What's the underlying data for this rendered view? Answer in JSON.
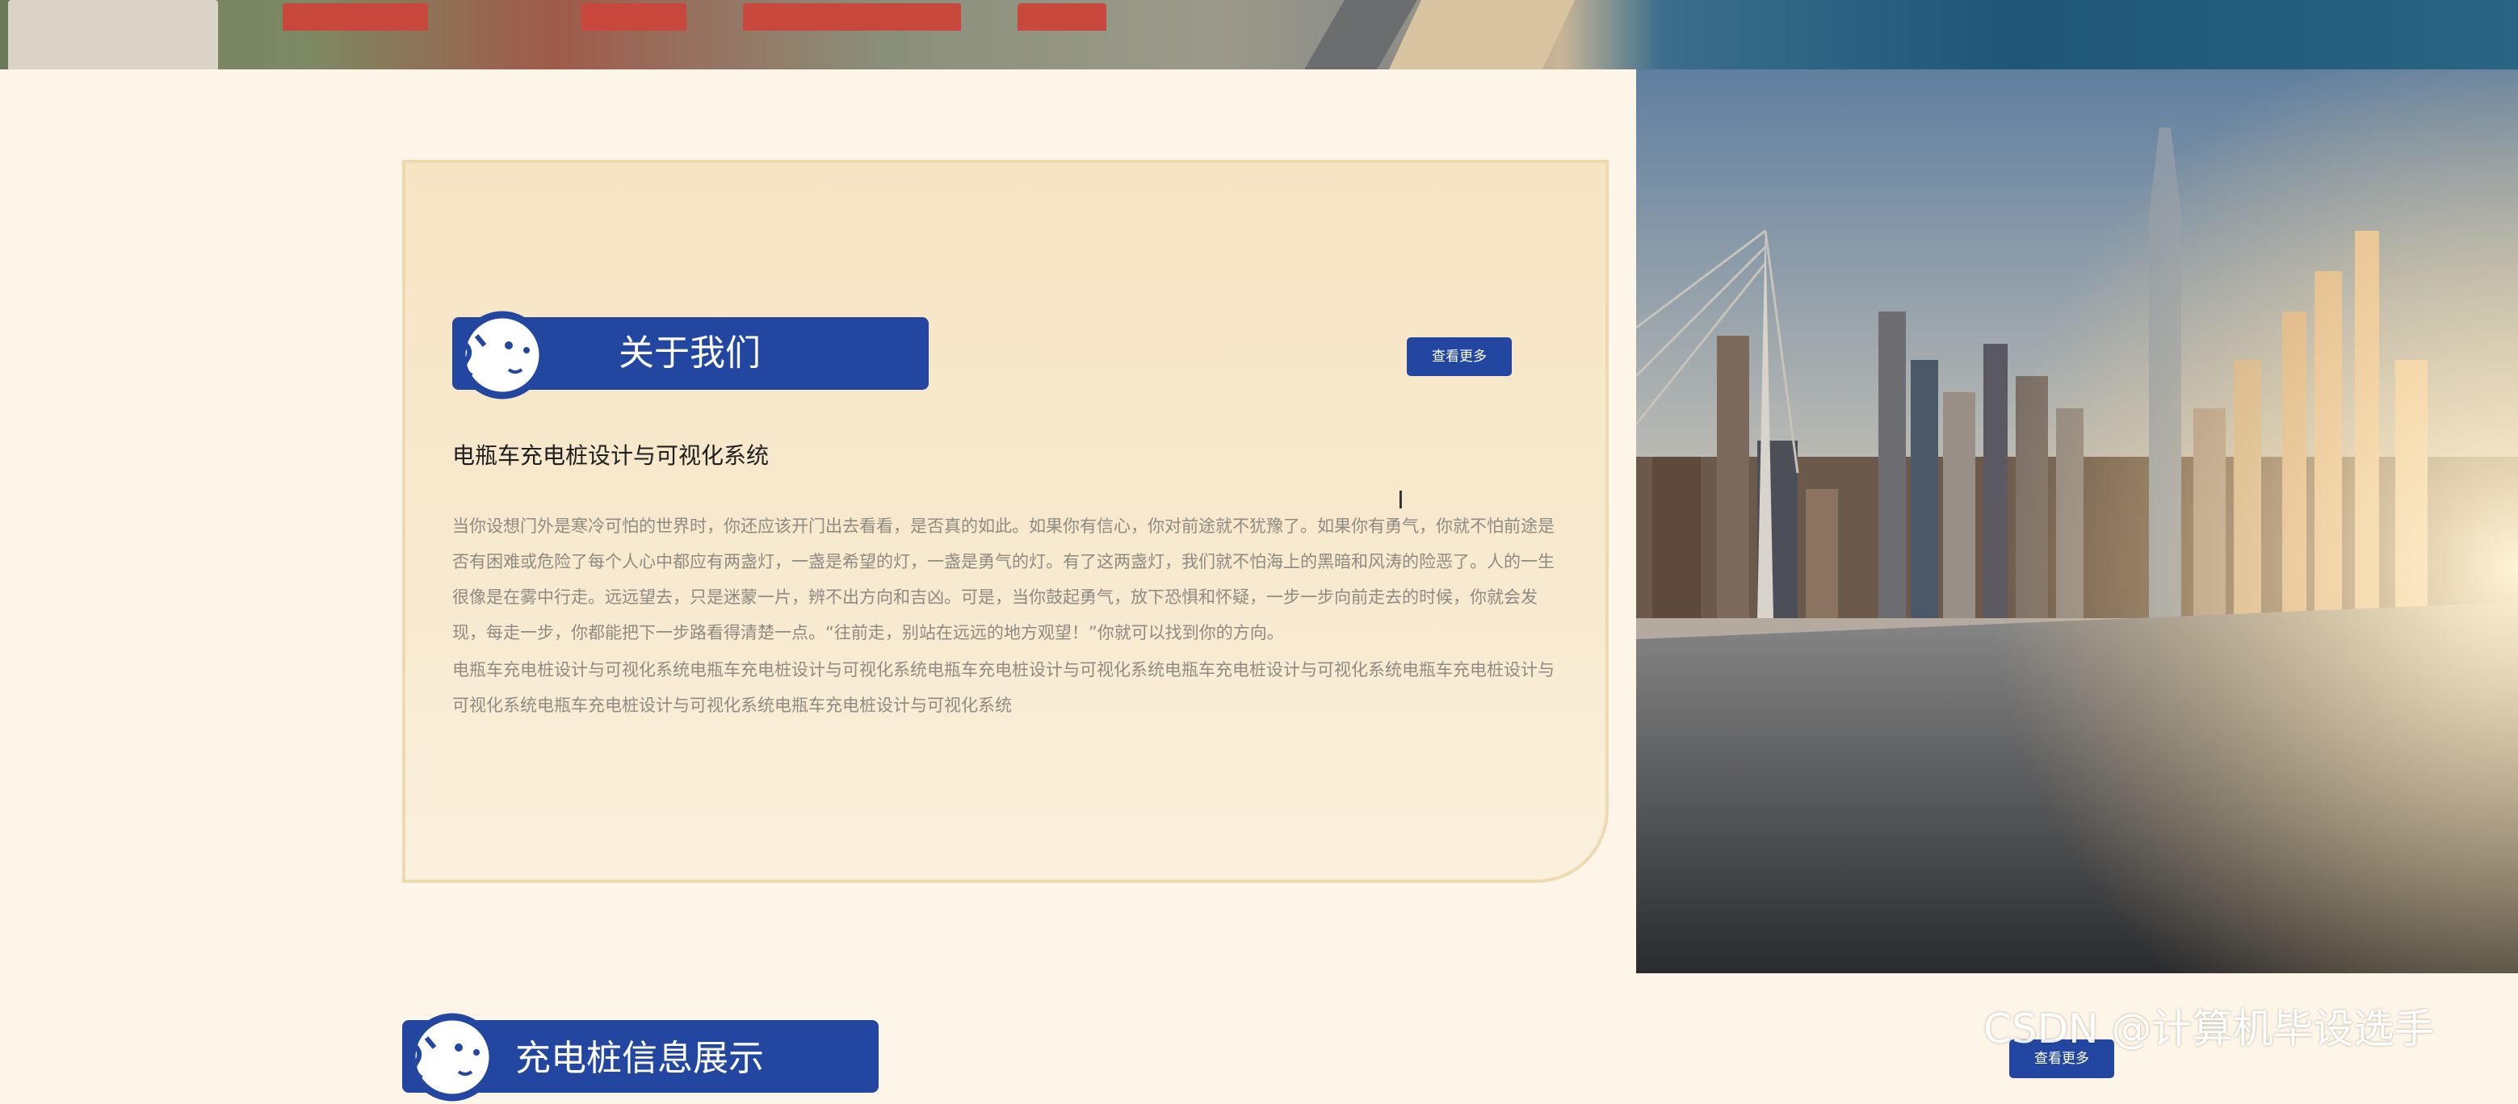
{
  "about": {
    "heading": "关于我们",
    "more_label": "查看更多",
    "system_title": "电瓶车充电桩设计与可视化系统",
    "paragraph1": "当你设想门外是寒冷可怕的世界时，你还应该开门出去看看，是否真的如此。如果你有信心，你对前途就不犹豫了。如果你有勇气，你就不怕前途是否有困难或危险了每个人心中都应有两盏灯，一盏是希望的灯，一盏是勇气的灯。有了这两盏灯，我们就不怕海上的黑暗和风涛的险恶了。人的一生很像是在雾中行走。远远望去，只是迷蒙一片，辨不出方向和吉凶。可是，当你鼓起勇气，放下恐惧和怀疑，一步一步向前走去的时候，你就会发现，每走一步，你都能把下一步路看得清楚一点。“往前走，别站在远远的地方观望！”你就可以找到你的方向。",
    "paragraph2": "电瓶车充电桩设计与可视化系统电瓶车充电桩设计与可视化系统电瓶车充电桩设计与可视化系统电瓶车充电桩设计与可视化系统电瓶车充电桩设计与可视化系统电瓶车充电桩设计与可视化系统电瓶车充电桩设计与可视化系统"
  },
  "charging": {
    "heading": "充电桩信息展示",
    "more_label": "查看更多"
  },
  "watermark": "CSDN @计算机毕设选手",
  "colors": {
    "accent": "#2347a0",
    "page_bg": "#fdf5e7",
    "card_bg": "#f6e5c3"
  },
  "icons": {
    "mascot": "mascot-icon",
    "cursor": "text-cursor-icon"
  }
}
